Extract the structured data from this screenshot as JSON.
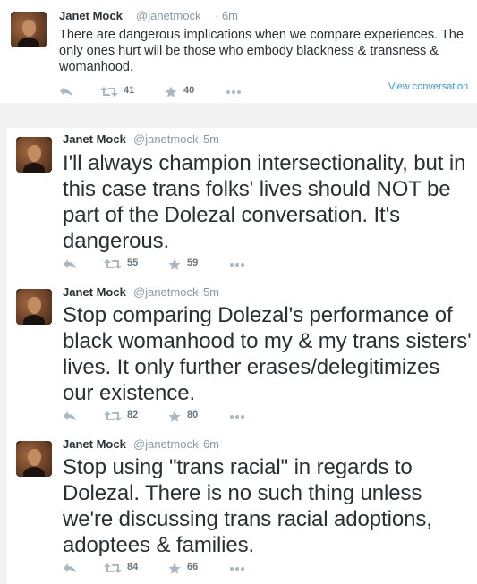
{
  "tweets": [
    {
      "author_name": "Janet Mock",
      "handle": "@janetmock",
      "time": "· 6m",
      "text": "There are dangerous implications when we compare experiences. The only ones hurt will be those who embody blackness & transness & womanhood.",
      "retweets": "41",
      "favorites": "40",
      "view_conversation": "View conversation"
    },
    {
      "author_name": "Janet Mock",
      "handle": "@janetmock",
      "time": "· 5m",
      "text": "I'll always champion intersectionality, but in this case trans folks' lives should NOT be part of the Dolezal conversation. It's dangerous.",
      "retweets": "55",
      "favorites": "59"
    },
    {
      "author_name": "Janet Mock",
      "handle": "@janetmock",
      "time": "· 5m",
      "text": "Stop comparing Dolezal's performance of black womanhood to my & my trans sisters' lives. It only further erases/delegitimizes our existence.",
      "retweets": "82",
      "favorites": "80"
    },
    {
      "author_name": "Janet Mock",
      "handle": "@janetmock",
      "time": "· 6m",
      "text": "Stop using \"trans racial\" in regards to Dolezal. There is no such thing unless we're discussing trans racial adoptions, adoptees & families.",
      "retweets": "84",
      "favorites": "66"
    }
  ],
  "icons": {
    "reply": "reply-icon",
    "retweet": "retweet-icon",
    "favorite": "star-icon",
    "more": "more-icon"
  },
  "colors": {
    "text": "#292f33",
    "muted": "#8899a6",
    "link": "#3b94d9",
    "background": "#f2f2f2"
  }
}
